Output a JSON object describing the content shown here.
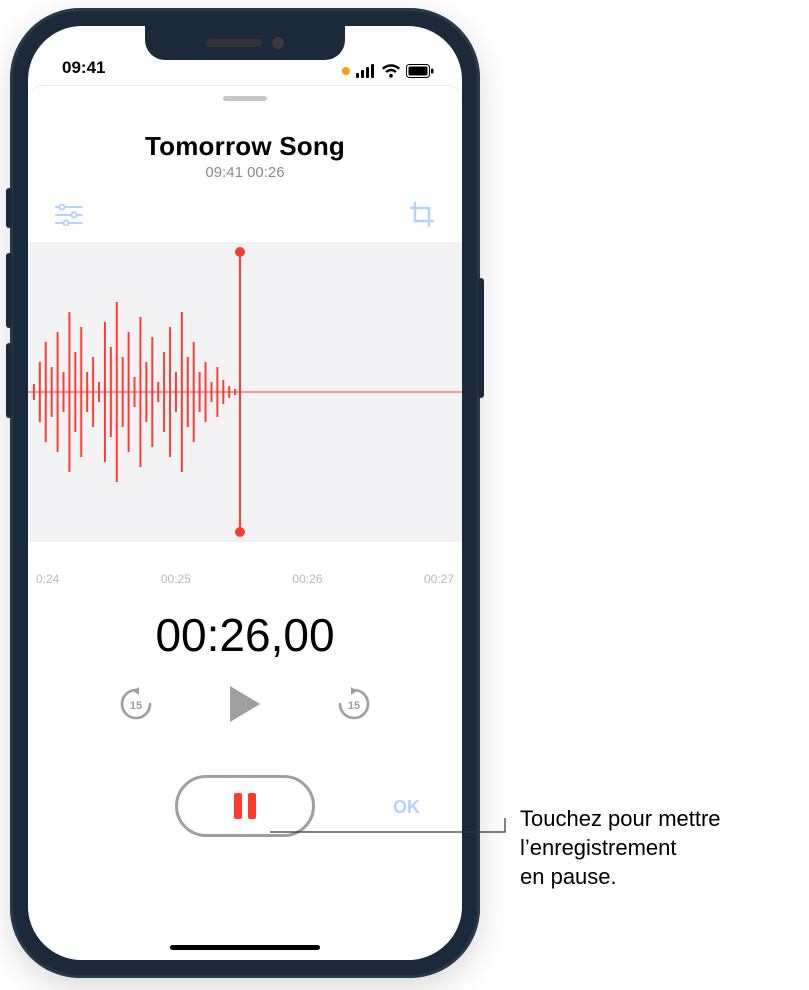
{
  "status": {
    "time": "09:41",
    "recording_dot_color": "#ff9f0a"
  },
  "recording": {
    "title": "Tomorrow Song",
    "subtitle": "09:41  00:26",
    "timecode_labels": [
      "0:24",
      "00:25",
      "00:26",
      "00:27"
    ],
    "elapsed": "00:26,00"
  },
  "controls": {
    "ok_label": "OK"
  },
  "callout": {
    "line1": "Touchez pour mettre",
    "line2": "l’enregistrement",
    "line3": "en pause."
  },
  "colors": {
    "accent_red": "#ff3b30",
    "disabled_blue": "#b7d1ff",
    "muted_grey": "#9e9ea3",
    "wave_bg": "#f3f3f5"
  }
}
